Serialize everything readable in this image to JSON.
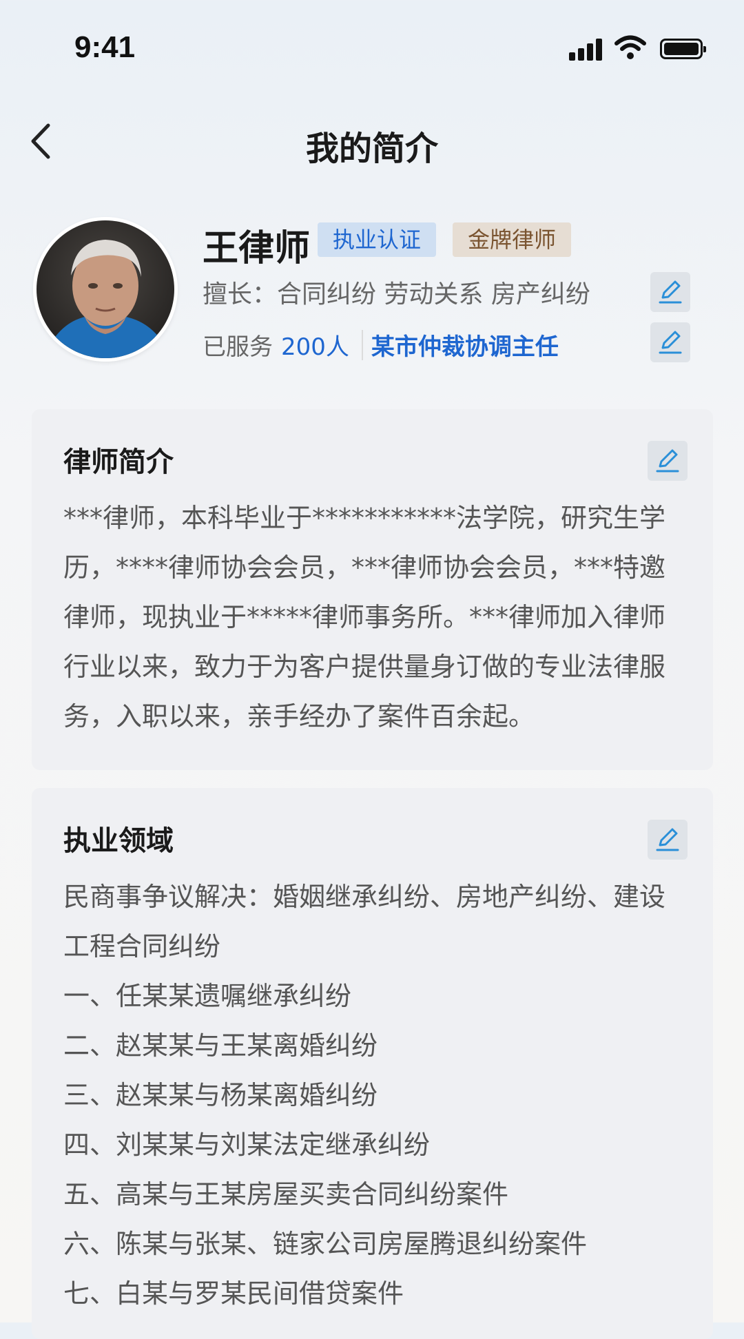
{
  "status_bar": {
    "time": "9:41"
  },
  "nav": {
    "title": "我的简介"
  },
  "profile": {
    "name": "王律师",
    "badges": [
      "执业认证",
      "金牌律师"
    ],
    "expertise": "擅长：合同纠纷 劳动关系 房产纠纷",
    "served_label": "已服务",
    "served_count": "200人",
    "role": "某市仲裁协调主任"
  },
  "intro": {
    "title": "律师简介",
    "text": "***律师，本科毕业于***********法学院，研究生学历，****律师协会会员，***律师协会会员，***特邀律师，现执业于*****律师事务所。***律师加入律师行业以来，致力于为客户提供量身订做的专业法律服务，入职以来，亲手经办了案件百余起。"
  },
  "practice": {
    "title": "执业领域",
    "items": [
      "民商事争议解决：婚姻继承纠纷、房地产纠纷、建设工程合同纠纷",
      "一、任某某遗嘱继承纠纷",
      "二、赵某某与王某离婚纠纷",
      "三、赵某某与杨某离婚纠纷",
      "四、刘某某与刘某法定继承纠纷",
      "五、高某与王某房屋买卖合同纠纷案件",
      "六、陈某与张某、链家公司房屋腾退纠纷案件",
      "七、白某与罗某民间借贷案件"
    ]
  },
  "icons": {
    "back": "chevron-left-icon",
    "edit": "edit-pencil-icon",
    "signal": "cellular-signal-icon",
    "wifi": "wifi-icon",
    "battery": "battery-icon"
  },
  "colors": {
    "accent_blue": "#1e66d0",
    "gold_text": "#7a5430",
    "edit_icon": "#2a8fd8",
    "card_bg": "#eff0f3"
  }
}
